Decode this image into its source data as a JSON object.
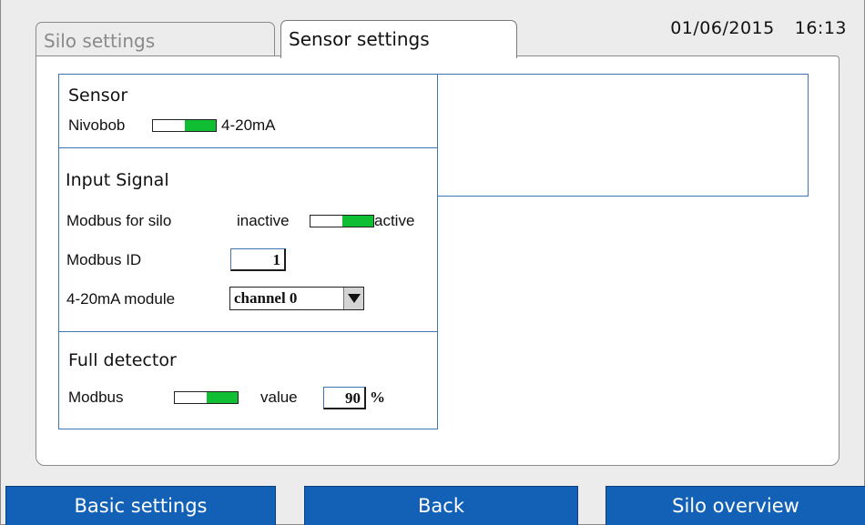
{
  "header": {
    "date": "01/06/2015",
    "time": "16:13"
  },
  "tabs": [
    {
      "label": "Silo settings",
      "active": false
    },
    {
      "label": "Sensor settings",
      "active": true
    }
  ],
  "sensor": {
    "title": "Sensor",
    "left_label": "Nivobob",
    "right_label": "4-20mA",
    "toggle_on": true
  },
  "input_signal": {
    "title": "Input Signal",
    "modbus_for_silo_label": "Modbus for silo",
    "inactive_label": "inactive",
    "active_label": "active",
    "modbus_toggle_on": true,
    "modbus_id_label": "Modbus ID",
    "modbus_id_value": "1",
    "module_label": "4-20mA module",
    "module_value": "channel 0"
  },
  "full_detector": {
    "title": "Full detector",
    "modbus_label": "Modbus",
    "toggle_on": true,
    "value_label": "value",
    "value": "90",
    "unit": "%"
  },
  "footer": {
    "basic_settings": "Basic settings",
    "back": "Back",
    "silo_overview": "Silo overview"
  },
  "colors": {
    "accent_blue": "#1261b7",
    "toggle_green": "#0fbe32",
    "frame_blue": "#3f74b5"
  }
}
